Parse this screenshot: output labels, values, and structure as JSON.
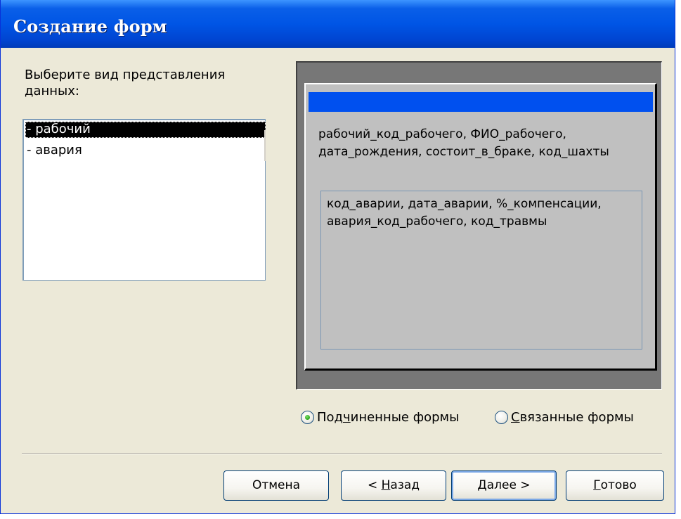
{
  "window": {
    "title": "Создание форм"
  },
  "left": {
    "prompt": "Выберите вид представления данных:",
    "items": [
      {
        "label": "- рабочий",
        "selected": true
      },
      {
        "label": "- авария",
        "selected": false
      }
    ]
  },
  "preview": {
    "main_fields": "рабочий_код_рабочего, ФИО_рабочего, дата_рождения, состоит_в_браке, код_шахты",
    "sub_fields": "код_аварии, дата_аварии, %_компенсации, авария_код_рабочего, код_травмы",
    "header_color": "#0050ef"
  },
  "options": {
    "subforms": {
      "pre": "Под",
      "key": "ч",
      "post": "иненные формы",
      "checked": true
    },
    "linked": {
      "pre": "",
      "key": "С",
      "post": "вязанные формы",
      "checked": false
    }
  },
  "buttons": {
    "cancel": {
      "pre": "Отмена",
      "key": "",
      "post": ""
    },
    "back": {
      "pre": "< ",
      "key": "Н",
      "post": "азад"
    },
    "next": {
      "pre": "",
      "key": "Д",
      "post": "алее >"
    },
    "finish": {
      "pre": "",
      "key": "Г",
      "post": "отово"
    }
  },
  "colors": {
    "title_bar": "#0055e5",
    "dialog_bg": "#ece9d8",
    "selection_bg": "#000000"
  }
}
